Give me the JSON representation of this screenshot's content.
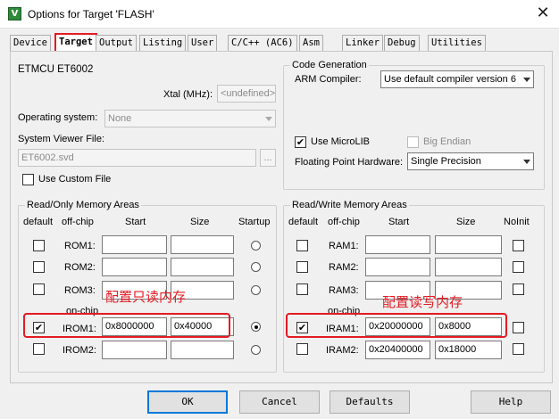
{
  "window": {
    "title": "Options for Target 'FLASH'",
    "icon": "uvision-icon",
    "close": "✕"
  },
  "tabs": [
    "Device",
    "Target",
    "Output",
    "Listing",
    "User",
    "C/C++ (AC6)",
    "Asm",
    "Linker",
    "Debug",
    "Utilities"
  ],
  "active_tab": "Target",
  "device_name": "ETMCU ET6002",
  "xtal": {
    "label": "Xtal (MHz):",
    "value": "<undefined>"
  },
  "os": {
    "label": "Operating system:",
    "value": "None"
  },
  "svd": {
    "label": "System Viewer File:",
    "value": "ET6002.svd",
    "browse": "...",
    "custom_label": "Use Custom File",
    "custom_checked": false
  },
  "codegen": {
    "title": "Code Generation",
    "compiler_label": "ARM Compiler:",
    "compiler_value": "Use default compiler version 6",
    "microlib_label": "Use MicroLIB",
    "microlib_checked": true,
    "bigendian_label": "Big Endian",
    "bigendian_checked": false,
    "fp_label": "Floating Point Hardware:",
    "fp_value": "Single Precision"
  },
  "rom": {
    "title": "Read/Only Memory Areas",
    "headers": {
      "default": "default",
      "offchip": "off-chip",
      "start": "Start",
      "size": "Size",
      "startup": "Startup"
    },
    "onchip_label": "on-chip",
    "rows": [
      {
        "name": "ROM1:",
        "start": "",
        "size": "",
        "default": false,
        "startup": false
      },
      {
        "name": "ROM2:",
        "start": "",
        "size": "",
        "default": false,
        "startup": false
      },
      {
        "name": "ROM3:",
        "start": "",
        "size": "",
        "default": false,
        "startup": false
      },
      {
        "name": "IROM1:",
        "start": "0x8000000",
        "size": "0x40000",
        "default": true,
        "startup": true
      },
      {
        "name": "IROM2:",
        "start": "",
        "size": "",
        "default": false,
        "startup": false
      }
    ]
  },
  "ram": {
    "title": "Read/Write Memory Areas",
    "headers": {
      "default": "default",
      "offchip": "off-chip",
      "start": "Start",
      "size": "Size",
      "noinit": "NoInit"
    },
    "onchip_label": "on-chip",
    "rows": [
      {
        "name": "RAM1:",
        "start": "",
        "size": "",
        "default": false,
        "noinit": false
      },
      {
        "name": "RAM2:",
        "start": "",
        "size": "",
        "default": false,
        "noinit": false
      },
      {
        "name": "RAM3:",
        "start": "",
        "size": "",
        "default": false,
        "noinit": false
      },
      {
        "name": "IRAM1:",
        "start": "0x20000000",
        "size": "0x8000",
        "default": true,
        "noinit": false
      },
      {
        "name": "IRAM2:",
        "start": "0x20400000",
        "size": "0x18000",
        "default": false,
        "noinit": false
      }
    ]
  },
  "annotations": {
    "rom": "配置只读内存",
    "ram": "配置读写内存"
  },
  "buttons": {
    "ok": "OK",
    "cancel": "Cancel",
    "defaults": "Defaults",
    "help": "Help"
  },
  "colors": {
    "highlight": "#e31b23",
    "default_button_border": "#0078d7"
  }
}
